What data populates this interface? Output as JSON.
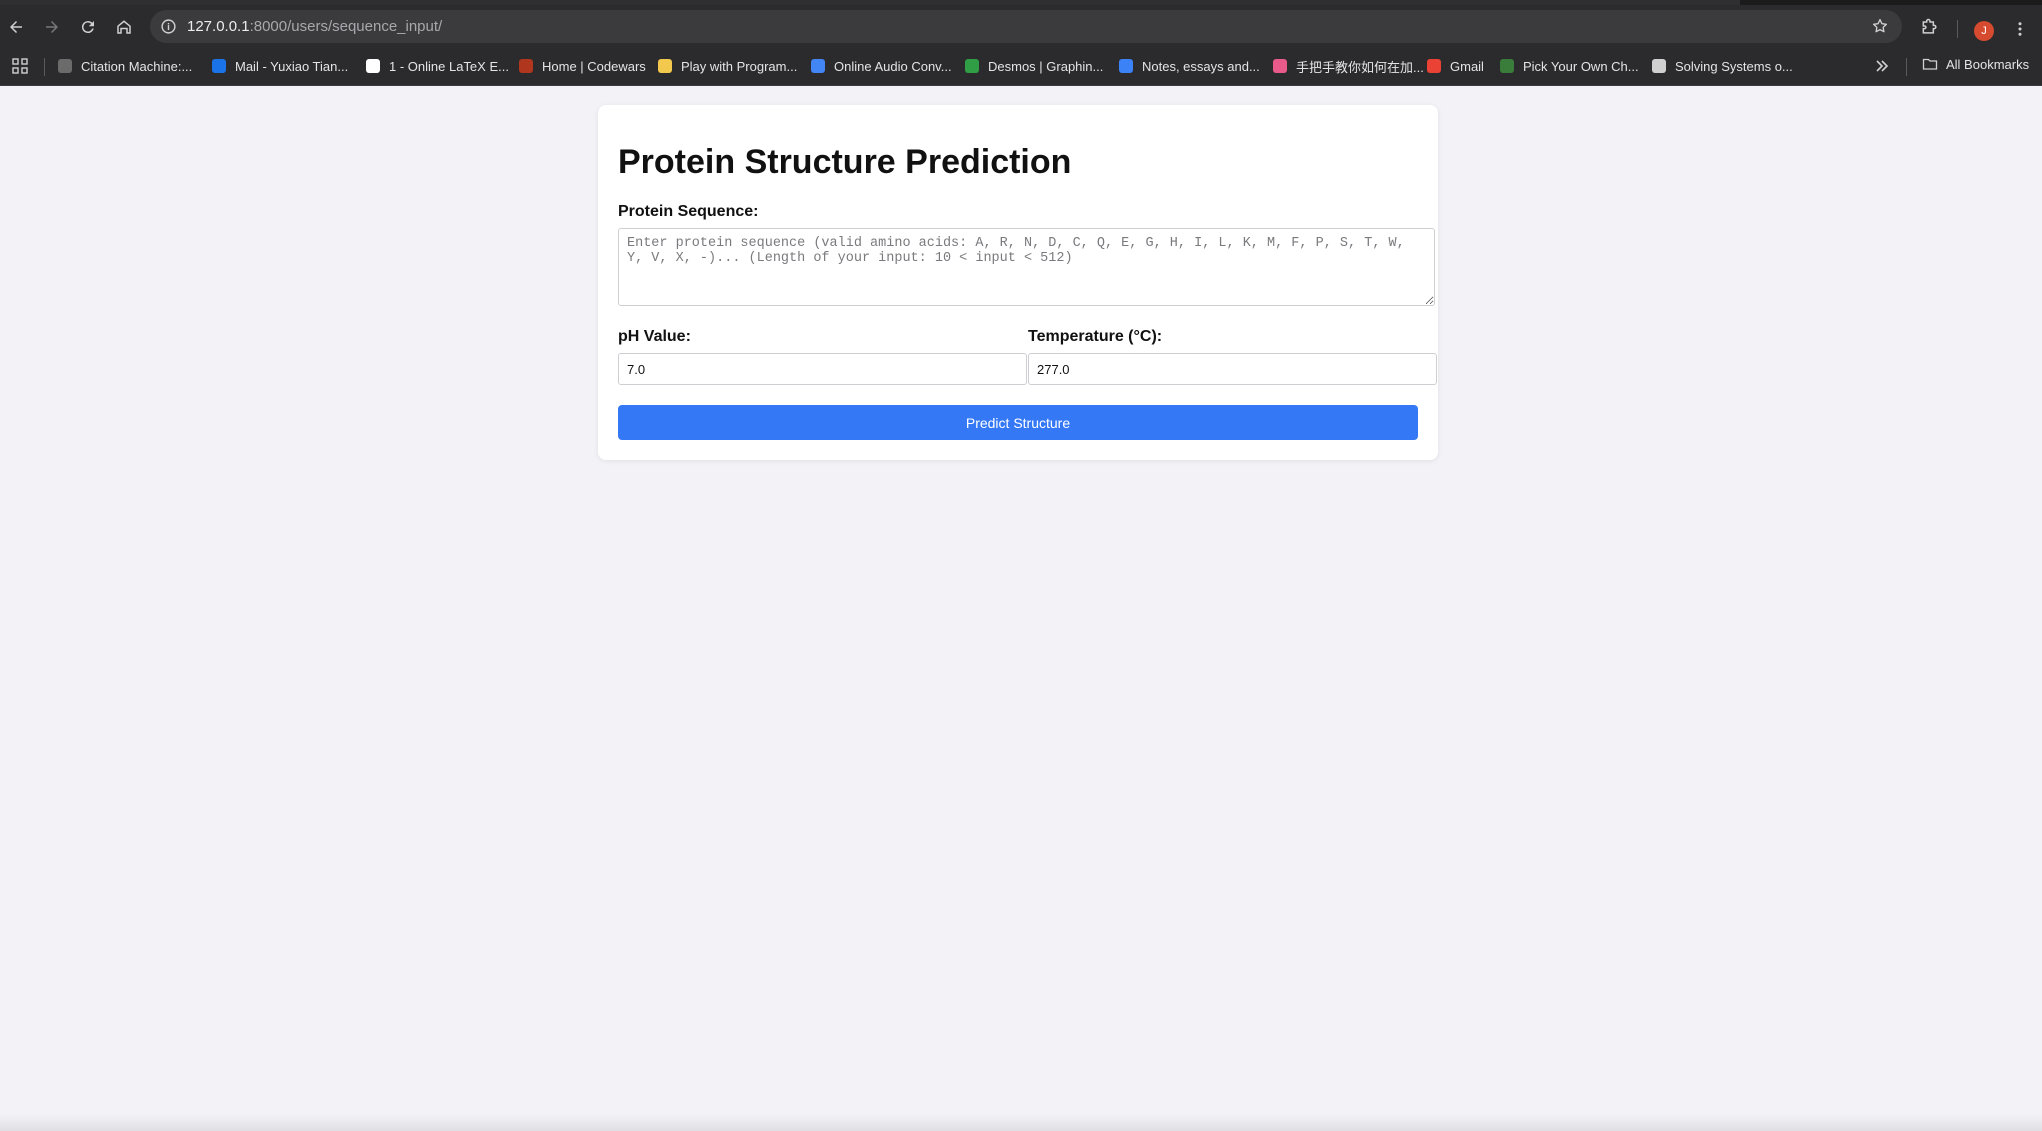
{
  "browser": {
    "url_host": "127.0.0.1",
    "url_rest": ":8000/users/sequence_input/",
    "profile_initial": "J",
    "bookmarks": [
      {
        "label": "Citation Machine:...",
        "icon": "citation-machine-icon",
        "color": "#6b6b6b"
      },
      {
        "label": "Mail - Yuxiao Tian...",
        "icon": "outlook-icon",
        "color": "#1a73e8"
      },
      {
        "label": "1 - Online LaTeX E...",
        "icon": "overleaf-icon",
        "color": "#ffffff"
      },
      {
        "label": "Home | Codewars",
        "icon": "codewars-icon",
        "color": "#b1361e"
      },
      {
        "label": "Play with Program...",
        "icon": "program-icon",
        "color": "#f2c94c"
      },
      {
        "label": "Online Audio Conv...",
        "icon": "audio-converter-icon",
        "color": "#4285f4"
      },
      {
        "label": "Desmos | Graphin...",
        "icon": "desmos-icon",
        "color": "#2f9e44"
      },
      {
        "label": "Notes, essays and...",
        "icon": "notes-icon",
        "color": "#3b82f6"
      },
      {
        "label": "手把手教你如何在加...",
        "icon": "moon-icon",
        "color": "#e85a8a"
      },
      {
        "label": "Gmail",
        "icon": "gmail-icon",
        "color": "#ea4335"
      },
      {
        "label": "Pick Your Own Ch...",
        "icon": "pick-icon",
        "color": "#3a7d3a"
      },
      {
        "label": "Solving Systems o...",
        "icon": "solving-systems-icon",
        "color": "#d0d0d0"
      }
    ],
    "all_bookmarks_label": "All Bookmarks"
  },
  "page": {
    "title": "Protein Structure Prediction",
    "sequence_label": "Protein Sequence:",
    "sequence_placeholder": "Enter protein sequence (valid amino acids: A, R, N, D, C, Q, E, G, H, I, L, K, M, F, P, S, T, W, Y, V, X, -)... (Length of your input: 10 < input < 512)",
    "sequence_value": "",
    "ph_label": "pH Value:",
    "ph_value": "7.0",
    "temp_label": "Temperature (°C):",
    "temp_value": "277.0",
    "submit_label": "Predict Structure",
    "accent_color": "#3478f6"
  }
}
